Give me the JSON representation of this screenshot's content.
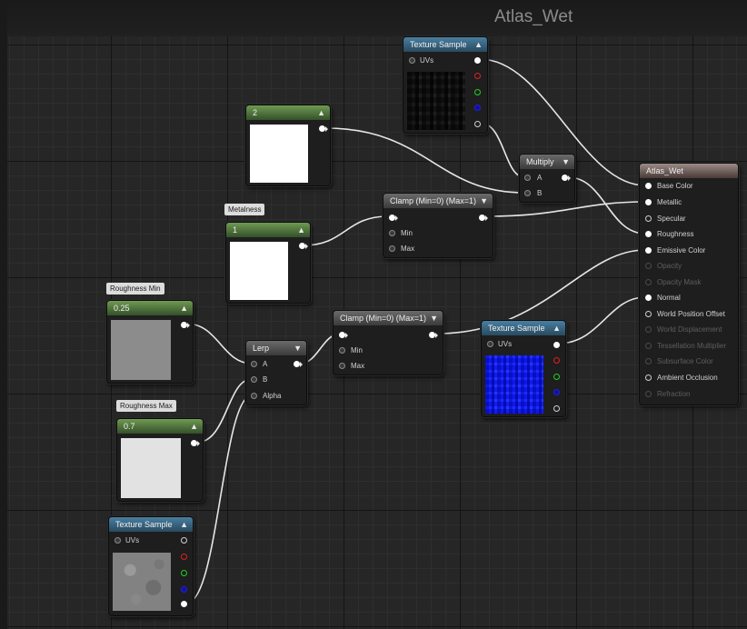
{
  "graph": {
    "title": "Atlas_Wet"
  },
  "colors": {
    "texture_header": "#284a60",
    "constant_header": "#34502a",
    "math_header": "#3a3a3a",
    "result_header": "#4a3a36",
    "wire": "#e6e6e6"
  },
  "nodes": {
    "texture_top": {
      "title": "Texture Sample",
      "uvs": "UVs"
    },
    "const2": {
      "value": "2"
    },
    "metalness": {
      "comment": "Metalness",
      "value": "1"
    },
    "clamp_top": {
      "title": "Clamp (Min=0) (Max=1)",
      "min": "Min",
      "max": "Max"
    },
    "multiply": {
      "title": "Multiply",
      "a": "A",
      "b": "B"
    },
    "rough_min": {
      "comment": "Roughness Min",
      "value": "0.25"
    },
    "rough_max": {
      "comment": "Roughness Max",
      "value": "0.7"
    },
    "lerp": {
      "title": "Lerp",
      "a": "A",
      "b": "B",
      "alpha": "Alpha"
    },
    "clamp_mid": {
      "title": "Clamp (Min=0) (Max=1)",
      "min": "Min",
      "max": "Max"
    },
    "texture_normal": {
      "title": "Texture Sample",
      "uvs": "UVs"
    },
    "texture_bottom": {
      "title": "Texture Sample",
      "uvs": "UVs"
    },
    "result": {
      "title": "Atlas_Wet",
      "inputs": [
        {
          "label": "Base Color",
          "enabled": true
        },
        {
          "label": "Metallic",
          "enabled": true
        },
        {
          "label": "Specular",
          "enabled": true
        },
        {
          "label": "Roughness",
          "enabled": true
        },
        {
          "label": "Emissive Color",
          "enabled": true
        },
        {
          "label": "Opacity",
          "enabled": false
        },
        {
          "label": "Opacity Mask",
          "enabled": false
        },
        {
          "label": "Normal",
          "enabled": true
        },
        {
          "label": "World Position Offset",
          "enabled": true
        },
        {
          "label": "World Displacement",
          "enabled": false
        },
        {
          "label": "Tessellation Multiplier",
          "enabled": false
        },
        {
          "label": "Subsurface Color",
          "enabled": false
        },
        {
          "label": "Ambient Occlusion",
          "enabled": true
        },
        {
          "label": "Refraction",
          "enabled": false
        }
      ]
    }
  }
}
